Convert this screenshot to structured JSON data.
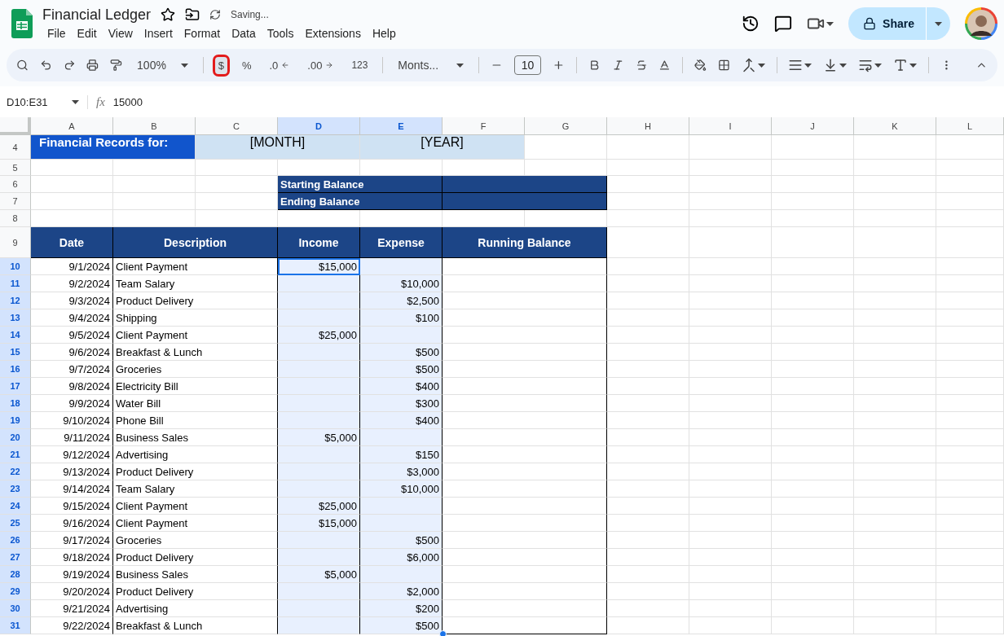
{
  "document": {
    "title": "Financial Ledger",
    "status": "Saving..."
  },
  "menu": [
    "File",
    "Edit",
    "View",
    "Insert",
    "Format",
    "Data",
    "Tools",
    "Extensions",
    "Help"
  ],
  "share": {
    "label": "Share"
  },
  "toolbar": {
    "zoom": "100%",
    "currency": {
      "label": "$",
      "highlighted": true
    },
    "percent": "%",
    "decimal_decrease": ".0",
    "decimal_increase": ".00",
    "number_format": "123",
    "font": "Monts...",
    "font_size": "10"
  },
  "formula_bar": {
    "name_box": "D10:E31",
    "function_label": "fx",
    "formula": "15000"
  },
  "columns": [
    {
      "label": "A",
      "selected": false
    },
    {
      "label": "B",
      "selected": false
    },
    {
      "label": "C",
      "selected": false
    },
    {
      "label": "D",
      "selected": true
    },
    {
      "label": "E",
      "selected": true
    },
    {
      "label": "F",
      "selected": false
    },
    {
      "label": "G",
      "selected": false
    },
    {
      "label": "H",
      "selected": false
    },
    {
      "label": "I",
      "selected": false
    },
    {
      "label": "J",
      "selected": false
    },
    {
      "label": "K",
      "selected": false
    },
    {
      "label": "L",
      "selected": false
    }
  ],
  "title_row": {
    "number": "4",
    "label": "Financial Records for:",
    "month": "[MONTH]",
    "year": "[YEAR]"
  },
  "blank_rows": [
    "5",
    "8"
  ],
  "balances": [
    {
      "number": "6",
      "label": "Starting Balance"
    },
    {
      "number": "7",
      "label": "Ending Balance"
    }
  ],
  "header_row": {
    "number": "9",
    "date": "Date",
    "description": "Description",
    "income": "Income",
    "expense": "Expense",
    "running": "Running Balance"
  },
  "entries": [
    {
      "number": "10",
      "date": "9/1/2024",
      "description": "Client Payment",
      "income": "$15,000",
      "active": true,
      "selected": true
    },
    {
      "number": "11",
      "date": "9/2/2024",
      "description": "Team Salary",
      "expense": "$10,000",
      "active": false,
      "selected": true
    },
    {
      "number": "12",
      "date": "9/3/2024",
      "description": "Product Delivery",
      "expense": "$2,500",
      "active": false,
      "selected": true
    },
    {
      "number": "13",
      "date": "9/4/2024",
      "description": "Shipping",
      "expense": "$100",
      "active": false,
      "selected": true
    },
    {
      "number": "14",
      "date": "9/5/2024",
      "description": "Client Payment",
      "income": "$25,000",
      "active": false,
      "selected": true
    },
    {
      "number": "15",
      "date": "9/6/2024",
      "description": "Breakfast & Lunch",
      "expense": "$500",
      "active": false,
      "selected": true
    },
    {
      "number": "16",
      "date": "9/7/2024",
      "description": "Groceries",
      "expense": "$500",
      "active": false,
      "selected": true
    },
    {
      "number": "17",
      "date": "9/8/2024",
      "description": "Electricity Bill",
      "expense": "$400",
      "active": false,
      "selected": true
    },
    {
      "number": "18",
      "date": "9/9/2024",
      "description": "Water Bill",
      "expense": "$300",
      "active": false,
      "selected": true
    },
    {
      "number": "19",
      "date": "9/10/2024",
      "description": "Phone Bill",
      "expense": "$400",
      "active": false,
      "selected": true
    },
    {
      "number": "20",
      "date": "9/11/2024",
      "description": "Business Sales",
      "income": "$5,000",
      "active": false,
      "selected": true
    },
    {
      "number": "21",
      "date": "9/12/2024",
      "description": "Advertising",
      "expense": "$150",
      "active": false,
      "selected": true
    },
    {
      "number": "22",
      "date": "9/13/2024",
      "description": "Product Delivery",
      "expense": "$3,000",
      "active": false,
      "selected": true
    },
    {
      "number": "23",
      "date": "9/14/2024",
      "description": "Team Salary",
      "expense": "$10,000",
      "active": false,
      "selected": true
    },
    {
      "number": "24",
      "date": "9/15/2024",
      "description": "Client Payment",
      "income": "$25,000",
      "active": false,
      "selected": true
    },
    {
      "number": "25",
      "date": "9/16/2024",
      "description": "Client Payment",
      "income": "$15,000",
      "active": false,
      "selected": true
    },
    {
      "number": "26",
      "date": "9/17/2024",
      "description": "Groceries",
      "expense": "$500",
      "active": false,
      "selected": true
    },
    {
      "number": "27",
      "date": "9/18/2024",
      "description": "Product Delivery",
      "expense": "$6,000",
      "active": false,
      "selected": true
    },
    {
      "number": "28",
      "date": "9/19/2024",
      "description": "Business Sales",
      "income": "$5,000",
      "active": false,
      "selected": true
    },
    {
      "number": "29",
      "date": "9/20/2024",
      "description": "Product Delivery",
      "expense": "$2,000",
      "active": false,
      "selected": true
    },
    {
      "number": "30",
      "date": "9/21/2024",
      "description": "Advertising",
      "expense": "$200",
      "active": false,
      "selected": true
    },
    {
      "number": "31",
      "date": "9/22/2024",
      "description": "Breakfast & Lunch",
      "expense": "$500",
      "active": false,
      "selected": true
    }
  ]
}
